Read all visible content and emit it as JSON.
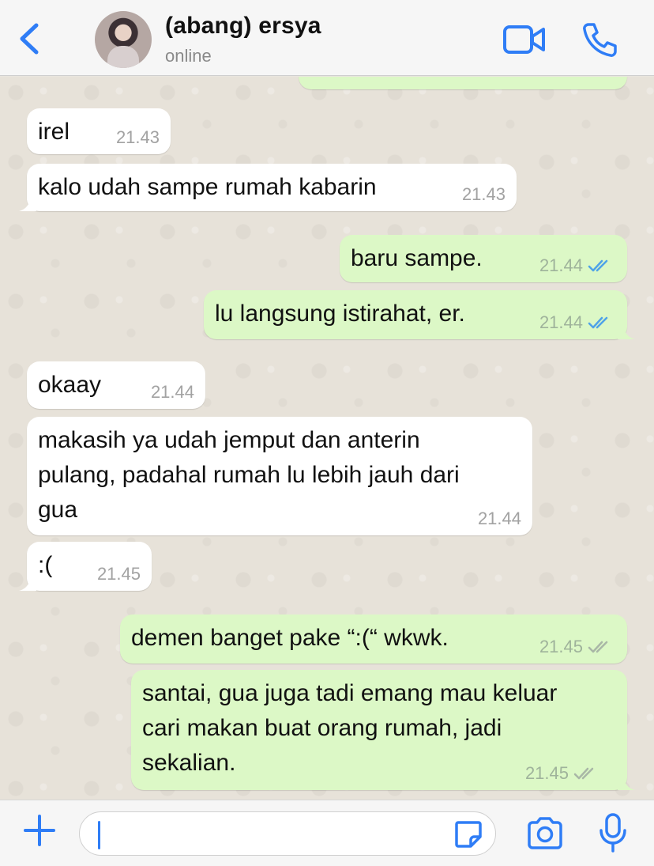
{
  "header": {
    "back_icon": "chevron-left-icon",
    "contact_name": "(abang) ersya",
    "status": "online",
    "video_icon": "video-camera-icon",
    "call_icon": "phone-icon"
  },
  "messages": [
    {
      "direction": "in",
      "text": "irel",
      "time": "21.43"
    },
    {
      "direction": "in",
      "text": "kalo udah sampe rumah kabarin",
      "time": "21.43"
    },
    {
      "direction": "out",
      "text": "baru sampe.",
      "time": "21.44",
      "status": "read"
    },
    {
      "direction": "out",
      "text": "lu langsung istirahat, er.",
      "time": "21.44",
      "status": "read"
    },
    {
      "direction": "in",
      "text": "okaay",
      "time": "21.44"
    },
    {
      "direction": "in",
      "text": "makasih ya udah jemput dan anterin\npulang, padahal rumah lu lebih jauh dari\ngua",
      "time": "21.44"
    },
    {
      "direction": "in",
      "text": ":(",
      "time": "21.45"
    },
    {
      "direction": "out",
      "text": "demen banget pake “:(“ wkwk.",
      "time": "21.45",
      "status": "delivered"
    },
    {
      "direction": "out",
      "text": "santai, gua juga tadi emang mau keluar\ncari makan buat orang rumah, jadi\nsekalian.",
      "time": "21.45",
      "status": "delivered"
    }
  ],
  "input": {
    "value": "",
    "plus_icon": "plus-icon",
    "sticker_icon": "sticker-icon",
    "camera_icon": "camera-icon",
    "mic_icon": "microphone-icon"
  },
  "colors": {
    "accent": "#2f7df6",
    "bubble_in": "#ffffff",
    "bubble_out": "#dcf8c6",
    "read_ticks": "#4fa3e8",
    "delivered_ticks": "#a9b7a6"
  }
}
